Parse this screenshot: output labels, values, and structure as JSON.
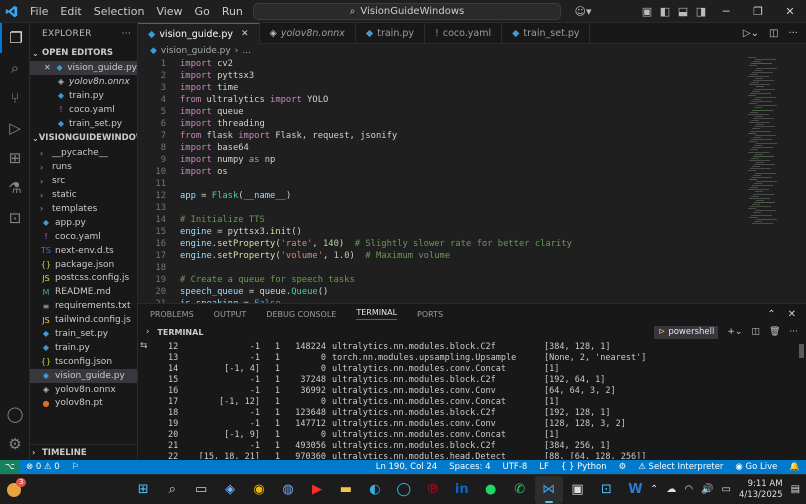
{
  "titlebar": {
    "menu": [
      "File",
      "Edit",
      "Selection",
      "View",
      "Go",
      "Run",
      "…"
    ],
    "search_text": "VisionGuideWindows"
  },
  "sidebar": {
    "header": "EXPLORER",
    "open_editors_label": "OPEN EDITORS",
    "open_editors": [
      {
        "name": "vision_guide.py",
        "icon": "py",
        "italic": false
      },
      {
        "name": "yolov8n.onnx",
        "icon": "onnx",
        "italic": true
      },
      {
        "name": "train.py",
        "icon": "py",
        "italic": false
      },
      {
        "name": "coco.yaml",
        "icon": "yaml",
        "italic": false
      },
      {
        "name": "train_set.py",
        "icon": "py",
        "italic": false
      }
    ],
    "project_label": "VISIONGUIDEWINDOWS",
    "folders": [
      "__pycache__",
      "runs",
      "src",
      "static",
      "templates"
    ],
    "files": [
      {
        "name": "app.py",
        "icon": "py"
      },
      {
        "name": "coco.yaml",
        "icon": "yaml"
      },
      {
        "name": "next-env.d.ts",
        "icon": "ts"
      },
      {
        "name": "package.json",
        "icon": "json"
      },
      {
        "name": "postcss.config.js",
        "icon": "js"
      },
      {
        "name": "README.md",
        "icon": "md"
      },
      {
        "name": "requirements.txt",
        "icon": "txt"
      },
      {
        "name": "tailwind.config.js",
        "icon": "js"
      },
      {
        "name": "train_set.py",
        "icon": "py"
      },
      {
        "name": "train.py",
        "icon": "py"
      },
      {
        "name": "tsconfig.json",
        "icon": "json"
      },
      {
        "name": "vision_guide.py",
        "icon": "py"
      },
      {
        "name": "yolov8n.onnx",
        "icon": "onnx"
      },
      {
        "name": "yolov8n.pt",
        "icon": "pt"
      }
    ],
    "timeline_label": "TIMELINE"
  },
  "tabs": [
    {
      "label": "vision_guide.py",
      "icon": "py",
      "active": true,
      "italic": false
    },
    {
      "label": "yolov8n.onnx",
      "icon": "onnx",
      "active": false,
      "italic": true
    },
    {
      "label": "train.py",
      "icon": "py",
      "active": false,
      "italic": false
    },
    {
      "label": "coco.yaml",
      "icon": "yaml",
      "active": false,
      "italic": false
    },
    {
      "label": "train_set.py",
      "icon": "py",
      "active": false,
      "italic": false
    }
  ],
  "breadcrumb": {
    "file": "vision_guide.py",
    "rest": "..."
  },
  "editor": {
    "lines": [
      {
        "n": "1",
        "tokens": [
          [
            "k1",
            "import"
          ],
          [
            "tx",
            " cv2"
          ]
        ]
      },
      {
        "n": "2",
        "tokens": [
          [
            "k1",
            "import"
          ],
          [
            "tx",
            " pyttsx3"
          ]
        ]
      },
      {
        "n": "3",
        "tokens": [
          [
            "k1",
            "import"
          ],
          [
            "tx",
            " time"
          ]
        ]
      },
      {
        "n": "4",
        "tokens": [
          [
            "k1",
            "from"
          ],
          [
            "tx",
            " ultralytics "
          ],
          [
            "k1",
            "import"
          ],
          [
            "tx",
            " YOLO"
          ]
        ]
      },
      {
        "n": "5",
        "tokens": [
          [
            "k1",
            "import"
          ],
          [
            "tx",
            " queue"
          ]
        ]
      },
      {
        "n": "6",
        "tokens": [
          [
            "k1",
            "import"
          ],
          [
            "tx",
            " threading"
          ]
        ]
      },
      {
        "n": "7",
        "tokens": [
          [
            "k1",
            "from"
          ],
          [
            "tx",
            " flask "
          ],
          [
            "k1",
            "import"
          ],
          [
            "tx",
            " Flask, request, jsonify"
          ]
        ]
      },
      {
        "n": "8",
        "tokens": [
          [
            "k1",
            "import"
          ],
          [
            "tx",
            " base64"
          ]
        ]
      },
      {
        "n": "9",
        "tokens": [
          [
            "k1",
            "import"
          ],
          [
            "tx",
            " numpy "
          ],
          [
            "k1",
            "as"
          ],
          [
            "tx",
            " np"
          ]
        ]
      },
      {
        "n": "10",
        "tokens": [
          [
            "k1",
            "import"
          ],
          [
            "tx",
            " os"
          ]
        ]
      },
      {
        "n": "11",
        "tokens": []
      },
      {
        "n": "12",
        "tokens": [
          [
            "vr",
            "app"
          ],
          [
            "tx",
            " = "
          ],
          [
            "cl",
            "Flask"
          ],
          [
            "tx",
            "("
          ],
          [
            "vr",
            "__name__"
          ],
          [
            "tx",
            ")"
          ]
        ]
      },
      {
        "n": "13",
        "tokens": []
      },
      {
        "n": "14",
        "tokens": [
          [
            "cm",
            "# Initialize TTS"
          ]
        ]
      },
      {
        "n": "15",
        "tokens": [
          [
            "vr",
            "engine"
          ],
          [
            "tx",
            " = pyttsx3."
          ],
          [
            "fn",
            "init"
          ],
          [
            "tx",
            "()"
          ]
        ]
      },
      {
        "n": "16",
        "tokens": [
          [
            "vr",
            "engine"
          ],
          [
            "tx",
            "."
          ],
          [
            "fn",
            "setProperty"
          ],
          [
            "tx",
            "("
          ],
          [
            "st",
            "'rate'"
          ],
          [
            "tx",
            ", "
          ],
          [
            "nm",
            "140"
          ],
          [
            "tx",
            ")  "
          ],
          [
            "cm",
            "# Slightly slower rate for better clarity"
          ]
        ]
      },
      {
        "n": "17",
        "tokens": [
          [
            "vr",
            "engine"
          ],
          [
            "tx",
            "."
          ],
          [
            "fn",
            "setProperty"
          ],
          [
            "tx",
            "("
          ],
          [
            "st",
            "'volume'"
          ],
          [
            "tx",
            ", "
          ],
          [
            "nm",
            "1.0"
          ],
          [
            "tx",
            ")  "
          ],
          [
            "cm",
            "# Maximum volume"
          ]
        ]
      },
      {
        "n": "18",
        "tokens": []
      },
      {
        "n": "19",
        "tokens": [
          [
            "cm",
            "# Create a queue for speech tasks"
          ]
        ]
      },
      {
        "n": "20",
        "tokens": [
          [
            "vr",
            "speech_queue"
          ],
          [
            "tx",
            " = queue."
          ],
          [
            "cl",
            "Queue"
          ],
          [
            "tx",
            "()"
          ]
        ]
      },
      {
        "n": "21",
        "tokens": [
          [
            "vr",
            "is_speaking"
          ],
          [
            "tx",
            " = "
          ],
          [
            "k2",
            "False"
          ]
        ]
      }
    ]
  },
  "panel": {
    "tabs": [
      "PROBLEMS",
      "OUTPUT",
      "DEBUG CONSOLE",
      "TERMINAL",
      "PORTS"
    ],
    "active_tab": "TERMINAL",
    "terminal_label": "TERMINAL",
    "shell": "powershell"
  },
  "terminal_rows": [
    [
      "12",
      "-1",
      "1",
      "148224",
      "ultralytics.nn.modules.block.C2f",
      "[384, 128, 1]"
    ],
    [
      "13",
      "-1",
      "1",
      "0",
      "torch.nn.modules.upsampling.Upsample",
      "[None, 2, 'nearest']"
    ],
    [
      "14",
      "[-1, 4]",
      "1",
      "0",
      "ultralytics.nn.modules.conv.Concat",
      "[1]"
    ],
    [
      "15",
      "-1",
      "1",
      "37248",
      "ultralytics.nn.modules.block.C2f",
      "[192, 64, 1]"
    ],
    [
      "16",
      "-1",
      "1",
      "36992",
      "ultralytics.nn.modules.conv.Conv",
      "[64, 64, 3, 2]"
    ],
    [
      "17",
      "[-1, 12]",
      "1",
      "0",
      "ultralytics.nn.modules.conv.Concat",
      "[1]"
    ],
    [
      "18",
      "-1",
      "1",
      "123648",
      "ultralytics.nn.modules.block.C2f",
      "[192, 128, 1]"
    ],
    [
      "19",
      "-1",
      "1",
      "147712",
      "ultralytics.nn.modules.conv.Conv",
      "[128, 128, 3, 2]"
    ],
    [
      "20",
      "[-1, 9]",
      "1",
      "0",
      "ultralytics.nn.modules.conv.Concat",
      "[1]"
    ],
    [
      "21",
      "-1",
      "1",
      "493056",
      "ultralytics.nn.modules.block.C2f",
      "[384, 256, 1]"
    ],
    [
      "22",
      "[15, 18, 21]",
      "1",
      "970360",
      "ultralytics.nn.modules.head.Detect",
      "[88, [64, 128, 256]]"
    ]
  ],
  "statusbar": {
    "problems": "⊗ 0 ⚠ 0",
    "position": "Ln 190, Col 24",
    "spaces": "Spaces: 4",
    "encoding": "UTF-8",
    "eol": "LF",
    "language": "Python",
    "interpreter": "Select Interpreter",
    "golive": "Go Live"
  },
  "taskbar": {
    "time": "9:11 AM",
    "date": "4/13/2025",
    "badge": "3"
  },
  "colors": {
    "accent": "#007acc",
    "activity_active": "#0078d4"
  }
}
